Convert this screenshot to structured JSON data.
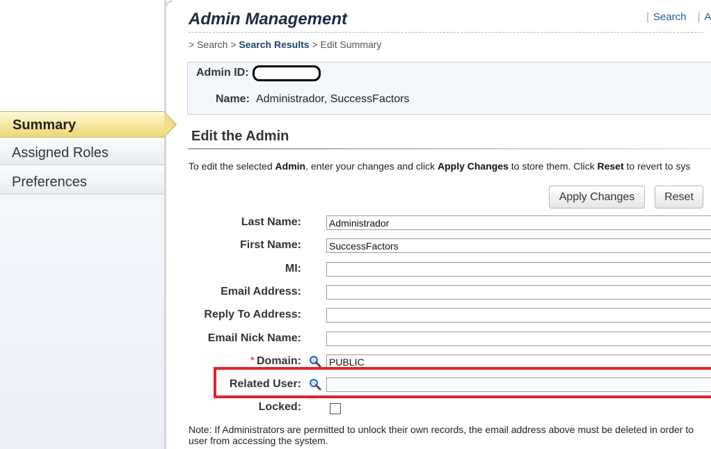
{
  "sidebar": {
    "items": [
      {
        "label": "Summary",
        "active": true
      },
      {
        "label": "Assigned Roles",
        "active": false
      },
      {
        "label": "Preferences",
        "active": false
      }
    ]
  },
  "header": {
    "title": "Admin Management",
    "links": [
      "Search",
      "A"
    ]
  },
  "breadcrumb": {
    "prefix": "> Search >",
    "link": "Search Results",
    "current": "> Edit Summary"
  },
  "info": {
    "admin_id_label": "Admin ID:",
    "admin_id_value": "",
    "name_label": "Name:",
    "name_value": "Administrador, SuccessFactors"
  },
  "section": {
    "title": "Edit the Admin",
    "instructions": {
      "p1": "To edit the selected ",
      "b1": "Admin",
      "p2": ", enter your changes and click ",
      "b2": "Apply Changes",
      "p3": " to store them. Click ",
      "b3": "Reset",
      "p4": " to revert to sys"
    }
  },
  "buttons": {
    "apply": "Apply Changes",
    "reset": "Reset"
  },
  "form": {
    "last_name": {
      "label": "Last Name:",
      "value": "Administrador"
    },
    "first_name": {
      "label": "First Name:",
      "value": "SuccessFactors"
    },
    "mi": {
      "label": "MI:",
      "value": ""
    },
    "email": {
      "label": "Email Address:",
      "value": ""
    },
    "reply_to": {
      "label": "Reply To Address:",
      "value": ""
    },
    "nick_name": {
      "label": "Email Nick Name:",
      "value": ""
    },
    "domain": {
      "label": "Domain:",
      "required_mark": "*",
      "value": "PUBLIC"
    },
    "related_user": {
      "label": "Related User:",
      "value": ""
    },
    "locked": {
      "label": "Locked:",
      "checked": false
    }
  },
  "note": {
    "line1": "Note: If Administrators are permitted to unlock their own records, the email address above must be deleted in order to",
    "line2": "user from accessing the system."
  },
  "colors": {
    "highlight": "#e0232c",
    "title": "#1f2a44",
    "link": "#2a5a9a",
    "active_nav": "#f2dd88"
  },
  "icons": {
    "lookup": "magnifier-icon"
  }
}
